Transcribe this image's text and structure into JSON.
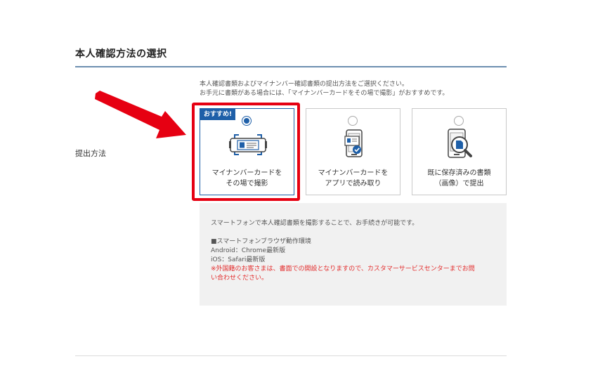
{
  "section": {
    "title": "本人確認方法の選択"
  },
  "form": {
    "label": "提出方法"
  },
  "intro": {
    "line1": "本人確認書類およびマイナンバー確認書類の提出方法をご選択ください。",
    "line2": "お手元に書類がある場合には、「マイナンバーカードをその場で撮影」がおすすめです。"
  },
  "options": [
    {
      "badge": "おすすめ!",
      "line1": "マイナンバーカードを",
      "line2": "その場で撮影",
      "selected": true,
      "icon": "id-card-camera-icon"
    },
    {
      "line1": "マイナンバーカードを",
      "line2": "アプリで読み取り",
      "selected": false,
      "icon": "smartphone-card-read-icon"
    },
    {
      "line1": "既に保存済みの書類",
      "line2": "（画像）で提出",
      "selected": false,
      "icon": "document-search-icon"
    }
  ],
  "info": {
    "line1": "スマートフォンで本人確認書類を撮影することで、お手続きが可能です。",
    "env_heading": "■スマートフォンブラウザ動作環境",
    "android": "Android：Chrome最新版",
    "ios": "iOS：Safari最新版",
    "note_line1": "※外国籍のお客さまは、書面での開設となりますので、カスタマーサービスセンターまでお問",
    "note_line2": "い合わせください。"
  },
  "colors": {
    "accent": "#1e5fa8",
    "annotation": "#e60012",
    "note_text": "#e32b2b",
    "info_bg": "#f1f1f1",
    "title_rule": "#6d8fb0"
  }
}
